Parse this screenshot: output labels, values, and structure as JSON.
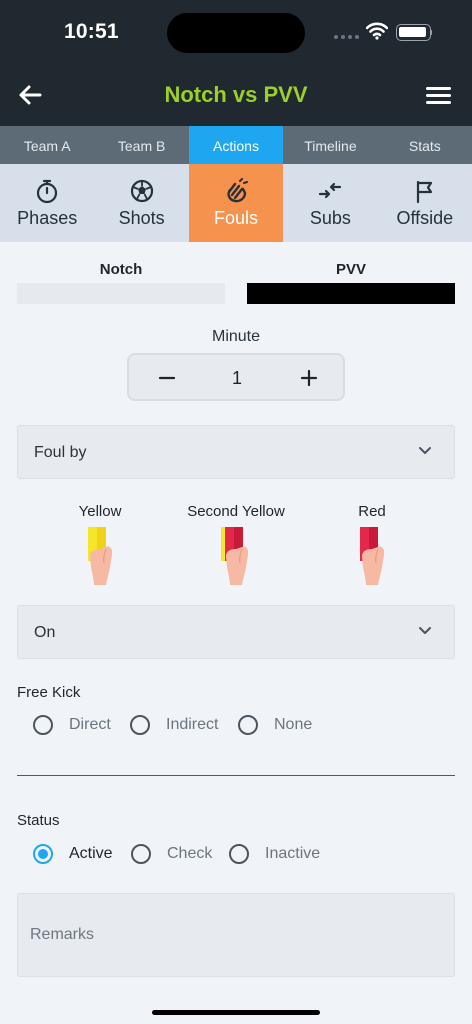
{
  "status_bar": {
    "time": "10:51"
  },
  "header": {
    "title": "Notch vs PVV"
  },
  "tabs": [
    {
      "label": "Team A",
      "active": false
    },
    {
      "label": "Team B",
      "active": false
    },
    {
      "label": "Actions",
      "active": true
    },
    {
      "label": "Timeline",
      "active": false
    },
    {
      "label": "Stats",
      "active": false
    }
  ],
  "actions": [
    {
      "label": "Phases",
      "icon": "stopwatch-icon",
      "active": false
    },
    {
      "label": "Shots",
      "icon": "soccer-ball-icon",
      "active": false
    },
    {
      "label": "Fouls",
      "icon": "foul-hand-icon",
      "active": true
    },
    {
      "label": "Subs",
      "icon": "swap-arrows-icon",
      "active": false
    },
    {
      "label": "Offside",
      "icon": "flag-icon",
      "active": false
    }
  ],
  "teams": {
    "a": {
      "name": "Notch",
      "color": "#e6e9ed"
    },
    "b": {
      "name": "PVV",
      "color": "#000000"
    }
  },
  "minute": {
    "label": "Minute",
    "value": "1"
  },
  "foul_by": {
    "placeholder": "Foul by"
  },
  "cards": [
    {
      "label": "Yellow"
    },
    {
      "label": "Second Yellow"
    },
    {
      "label": "Red"
    }
  ],
  "on_select": {
    "placeholder": "On"
  },
  "free_kick": {
    "label": "Free Kick",
    "options": [
      "Direct",
      "Indirect",
      "None"
    ]
  },
  "status": {
    "label": "Status",
    "options": [
      "Active",
      "Check",
      "Inactive"
    ],
    "selected": "Active"
  },
  "remarks": {
    "placeholder": "Remarks"
  },
  "colors": {
    "accent": "#1ea7f0",
    "active_action": "#f5924e",
    "title": "#9bd02a",
    "header_bg": "#202830"
  }
}
